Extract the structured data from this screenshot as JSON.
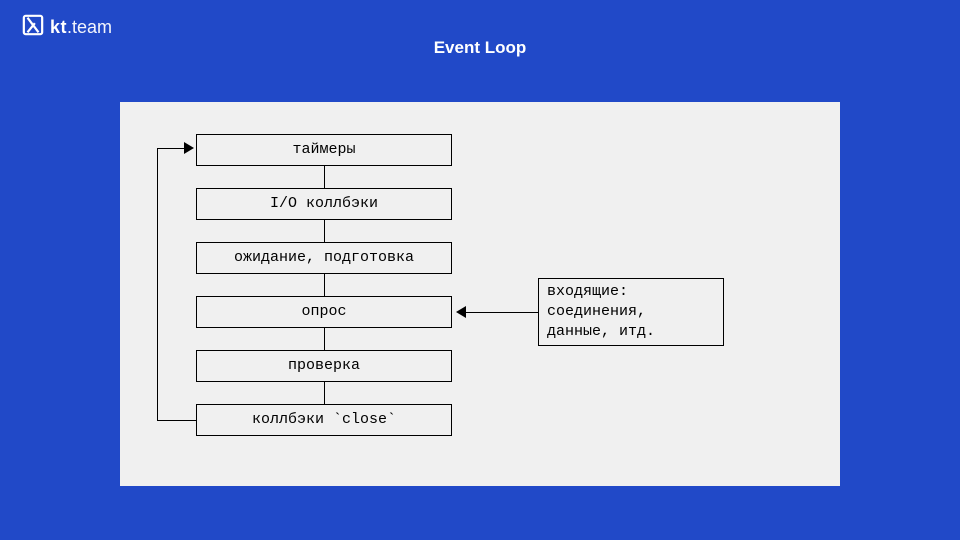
{
  "brand": {
    "kt": "kt",
    "team": ".team"
  },
  "title": "Event Loop",
  "nodes": {
    "n0": "таймеры",
    "n1": "I/O коллбэки",
    "n2": "ожидание, подготовка",
    "n3": "опрос",
    "n4": "проверка",
    "n5": "коллбэки `close`"
  },
  "side_node": "входящие:\nсоединения,\nданные, итд."
}
